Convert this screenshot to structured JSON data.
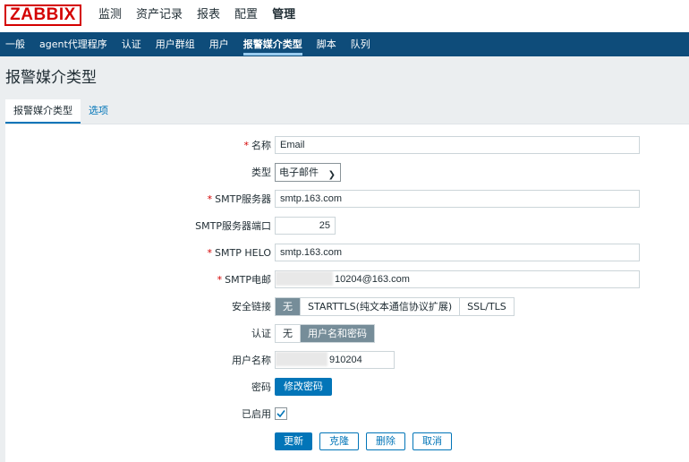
{
  "brand": {
    "logo_text": "ZABBIX",
    "color": "#d40000"
  },
  "top_nav": [
    "监测",
    "资产记录",
    "报表",
    "配置",
    "管理"
  ],
  "top_nav_active": "管理",
  "sub_nav": [
    "一般",
    "agent代理程序",
    "认证",
    "用户群组",
    "用户",
    "报警媒介类型",
    "脚本",
    "队列"
  ],
  "sub_nav_active": "报警媒介类型",
  "page_title": "报警媒介类型",
  "tabs": {
    "media_type": "报警媒介类型",
    "options": "选项"
  },
  "form": {
    "name": {
      "label": "名称",
      "value": "Email"
    },
    "type": {
      "label": "类型",
      "value": "电子邮件"
    },
    "smtp_server": {
      "label": "SMTP服务器",
      "value": "smtp.163.com"
    },
    "smtp_port": {
      "label": "SMTP服务器端口",
      "value": "25"
    },
    "smtp_helo": {
      "label": "SMTP HELO",
      "value": "smtp.163.com"
    },
    "smtp_email": {
      "label": "SMTP电邮",
      "value": "10204@163.com"
    },
    "security": {
      "label": "安全链接",
      "options": [
        "无",
        "STARTTLS(纯文本通信协议扩展)",
        "SSL/TLS"
      ],
      "selected": "无"
    },
    "auth": {
      "label": "认证",
      "options": [
        "无",
        "用户名和密码"
      ],
      "selected": "用户名和密码"
    },
    "username": {
      "label": "用户名称",
      "value": "910204"
    },
    "password": {
      "label": "密码",
      "button": "修改密码"
    },
    "enabled": {
      "label": "已启用",
      "checked": true
    }
  },
  "actions": {
    "update": "更新",
    "clone": "克隆",
    "delete": "删除",
    "cancel": "取消"
  },
  "colors": {
    "primary": "#0275b8",
    "nav_bg": "#0e4c7a",
    "selected_segment": "#768d99"
  }
}
